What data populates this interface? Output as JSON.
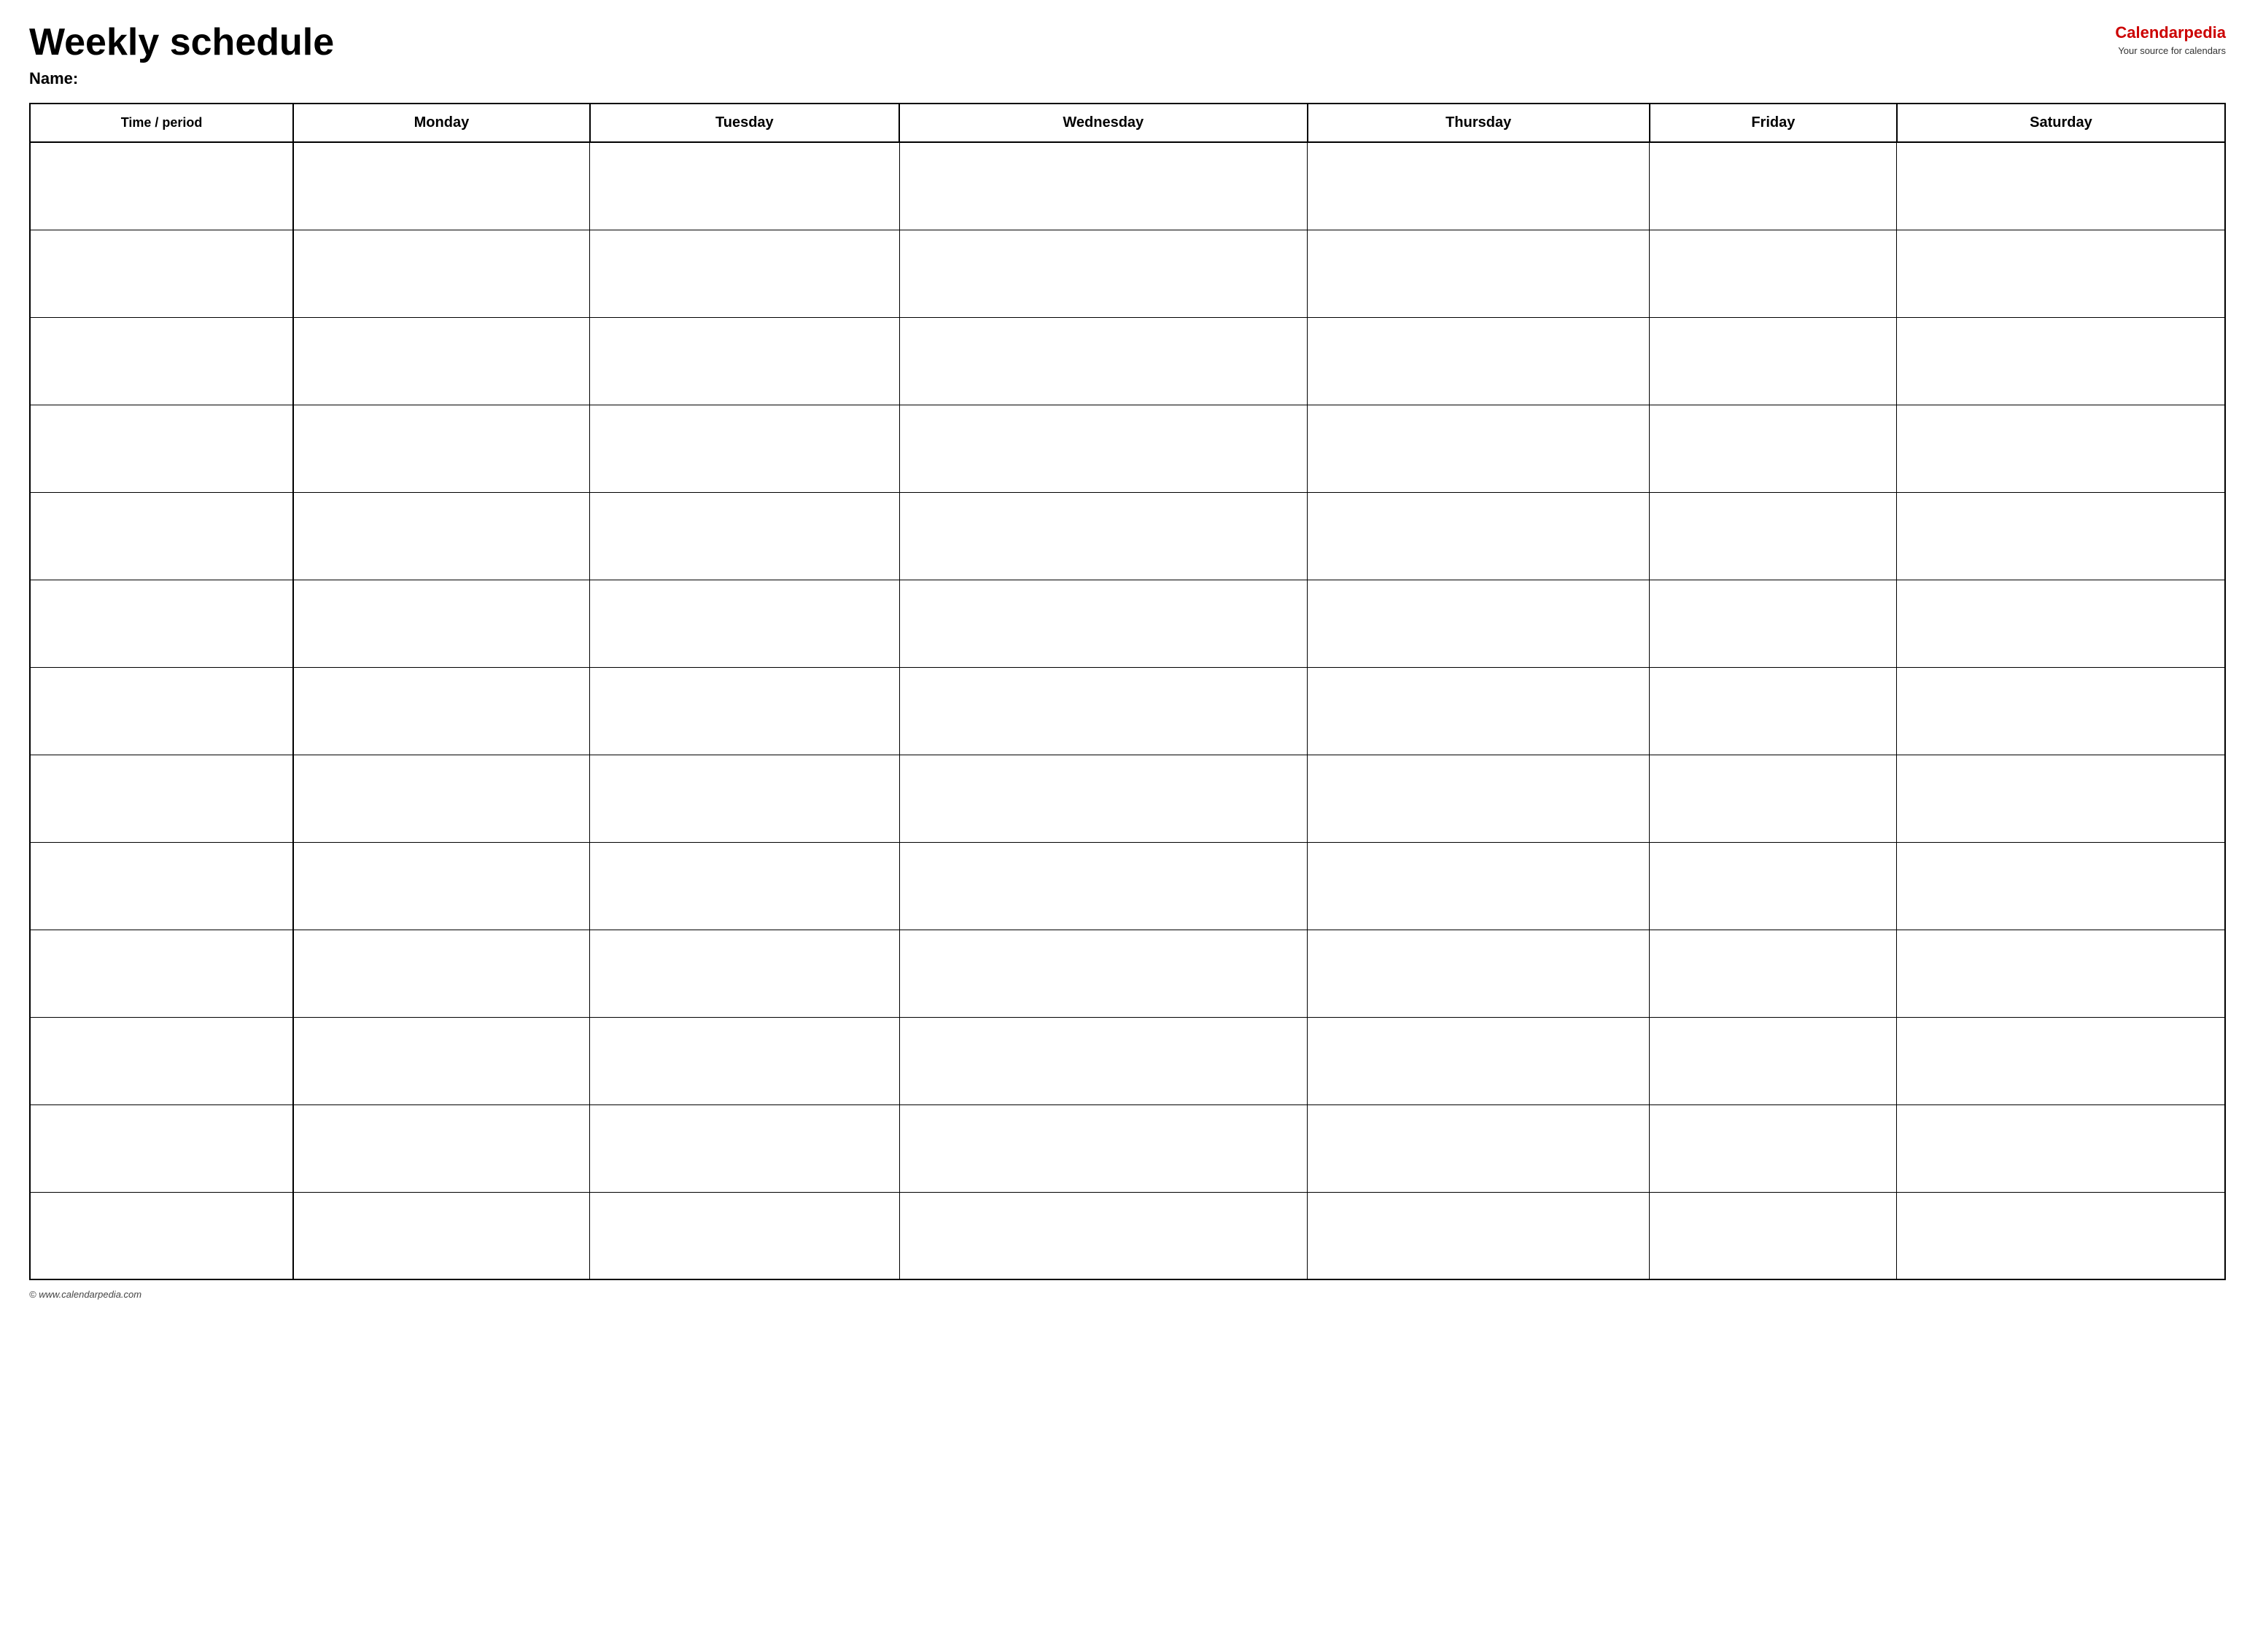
{
  "header": {
    "title": "Weekly schedule",
    "name_label": "Name:",
    "logo": {
      "brand_part1": "Calendar",
      "brand_part2": "pedia",
      "tagline": "Your source for calendars"
    }
  },
  "table": {
    "columns": [
      {
        "key": "time",
        "label": "Time / period"
      },
      {
        "key": "monday",
        "label": "Monday"
      },
      {
        "key": "tuesday",
        "label": "Tuesday"
      },
      {
        "key": "wednesday",
        "label": "Wednesday"
      },
      {
        "key": "thursday",
        "label": "Thursday"
      },
      {
        "key": "friday",
        "label": "Friday"
      },
      {
        "key": "saturday",
        "label": "Saturday"
      }
    ],
    "row_count": 13
  },
  "footer": {
    "copyright": "© www.calendarpedia.com"
  }
}
